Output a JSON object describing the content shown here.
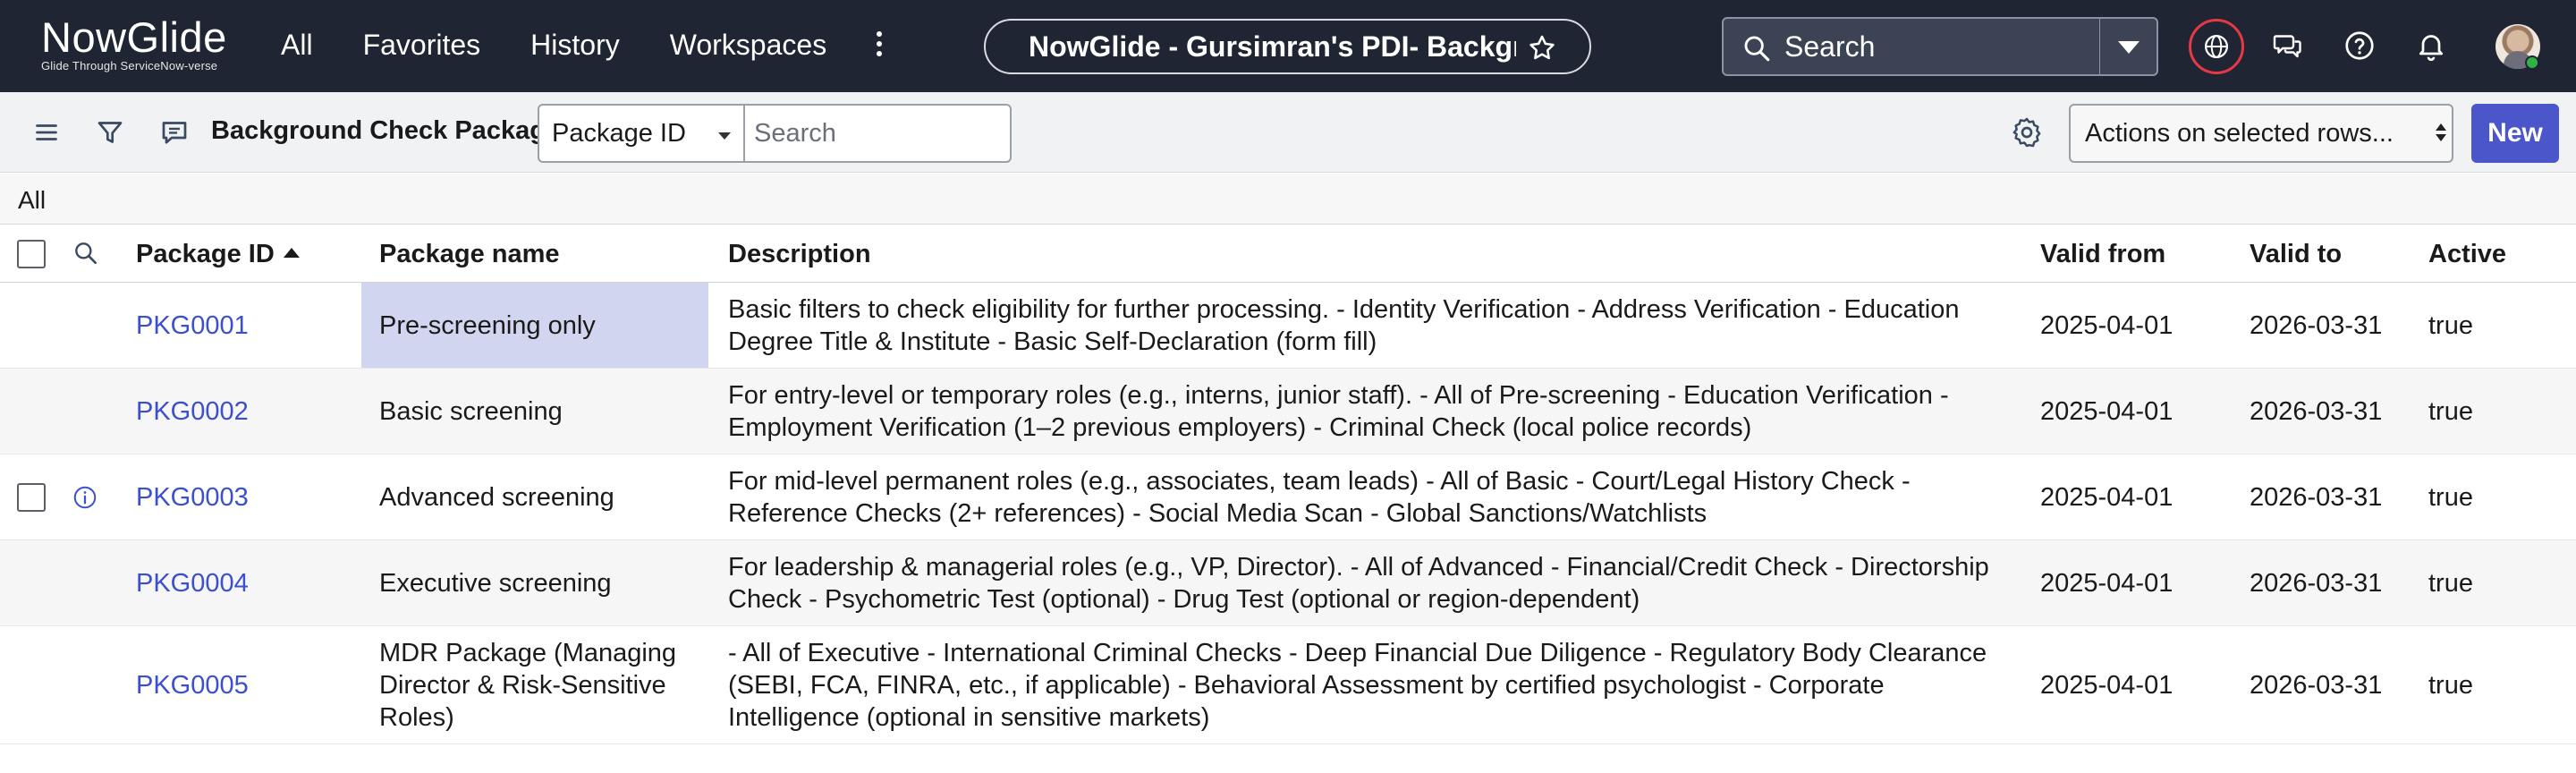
{
  "header": {
    "logo": {
      "part1": "Now",
      "part2": "Glide",
      "tagline": "Glide Through ServiceNow-verse"
    },
    "nav": [
      "All",
      "Favorites",
      "History",
      "Workspaces"
    ],
    "context_title": "NowGlide - Gursimran's PDI- Backgr...",
    "search_label": "Search"
  },
  "toolbar": {
    "list_title": "Background Check Packages",
    "field_select": "Package ID",
    "search_placeholder": "Search",
    "actions_label": "Actions on selected rows...",
    "new_label": "New"
  },
  "breadcrumb": "All",
  "table": {
    "columns": [
      "Package ID",
      "Package name",
      "Description",
      "Valid from",
      "Valid to",
      "Active"
    ],
    "sorted_column": "Package ID",
    "sort_direction": "ascending",
    "rows": [
      {
        "id": "PKG0001",
        "name": "Pre-screening only",
        "description": "Basic filters to check eligibility for further processing. - Identity Verification - Address Verification - Education Degree Title & Institute - Basic Self-Declaration (form fill)",
        "valid_from": "2025-04-01",
        "valid_to": "2026-03-31",
        "active": "true"
      },
      {
        "id": "PKG0002",
        "name": "Basic screening",
        "description": "For entry-level or temporary roles (e.g., interns, junior staff). - All of Pre-screening - Education Verification - Employment Verification (1–2 previous employers) - Criminal Check (local police records)",
        "valid_from": "2025-04-01",
        "valid_to": "2026-03-31",
        "active": "true"
      },
      {
        "id": "PKG0003",
        "name": "Advanced screening",
        "description": "For mid-level permanent roles (e.g., associates, team leads) - All of Basic - Court/Legal History Check - Reference Checks (2+ references) - Social Media Scan - Global Sanctions/Watchlists",
        "valid_from": "2025-04-01",
        "valid_to": "2026-03-31",
        "active": "true"
      },
      {
        "id": "PKG0004",
        "name": "Executive screening",
        "description": "For leadership & managerial roles (e.g., VP, Director). - All of Advanced - Financial/Credit Check - Directorship Check - Psychometric Test (optional) - Drug Test (optional or region-dependent)",
        "valid_from": "2025-04-01",
        "valid_to": "2026-03-31",
        "active": "true"
      },
      {
        "id": "PKG0005",
        "name": "MDR Package (Managing Director & Risk-Sensitive Roles)",
        "description": "- All of Executive - International Criminal Checks - Deep Financial Due Diligence - Regulatory Body Clearance (SEBI, FCA, FINRA, etc., if applicable) - Behavioral Assessment by certified psychologist - Corporate Intelligence (optional in sensitive markets)",
        "valid_from": "2025-04-01",
        "valid_to": "2026-03-31",
        "active": "true"
      }
    ]
  },
  "icons": {
    "header": [
      "star-icon",
      "search-icon",
      "chevron-down-icon",
      "globe-icon",
      "chat-icon",
      "help-icon",
      "bell-icon",
      "avatar"
    ],
    "toolbar": [
      "menu-icon",
      "filter-icon",
      "comment-icon",
      "gear-icon"
    ],
    "table": [
      "checkbox",
      "search-icon",
      "info-icon"
    ]
  },
  "colors": {
    "header_bg": "#1f2532",
    "link": "#3b4fd4",
    "primary_button": "#4a56c9",
    "highlight_cell": "#d2d5f0",
    "alert_ring": "#e63946",
    "presence": "#2fb344"
  }
}
